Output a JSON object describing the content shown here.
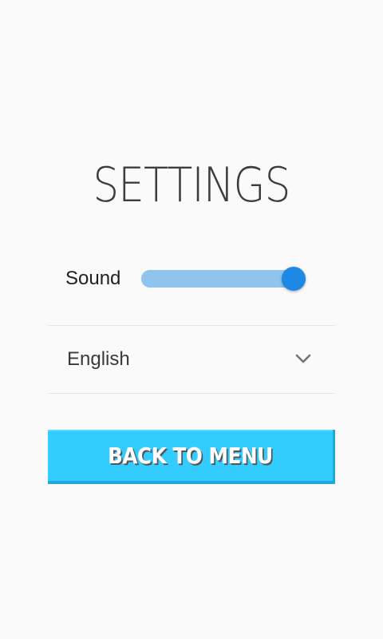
{
  "page": {
    "title": "SETTINGS"
  },
  "sound": {
    "label": "Sound",
    "value": 1.0
  },
  "language": {
    "selected": "English",
    "icon": "chevron-down-icon"
  },
  "back_button": {
    "label": "BACK TO MENU"
  },
  "colors": {
    "background": "#fafafa",
    "slider_track": "#90c4ef",
    "slider_thumb": "#1e88e5",
    "button": "#33ccff",
    "button_shadow": "#1fa8d8"
  }
}
